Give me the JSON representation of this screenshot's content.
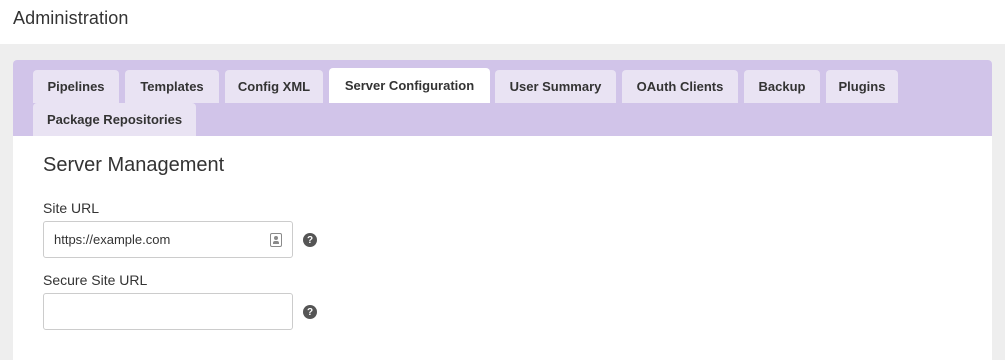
{
  "header": {
    "title": "Administration"
  },
  "tabs": [
    {
      "label": "Pipelines",
      "active": false
    },
    {
      "label": "Templates",
      "active": false
    },
    {
      "label": "Config XML",
      "active": false
    },
    {
      "label": "Server Configuration",
      "active": true
    },
    {
      "label": "User Summary",
      "active": false
    },
    {
      "label": "OAuth Clients",
      "active": false
    },
    {
      "label": "Backup",
      "active": false
    },
    {
      "label": "Plugins",
      "active": false
    },
    {
      "label": "Package Repositories",
      "active": false
    }
  ],
  "section": {
    "title": "Server Management"
  },
  "fields": {
    "site_url": {
      "label": "Site URL",
      "value": "https://example.com",
      "help_icon": "question-circle-icon",
      "autofill_icon": "contact-card-icon"
    },
    "secure_site_url": {
      "label": "Secure Site URL",
      "value": "",
      "help_icon": "question-circle-icon"
    }
  },
  "colors": {
    "tabbar_bg": "#d1c4e9",
    "tab_bg": "#e9e3f3",
    "tab_active_bg": "#ffffff",
    "page_bg": "#eeeeee"
  }
}
